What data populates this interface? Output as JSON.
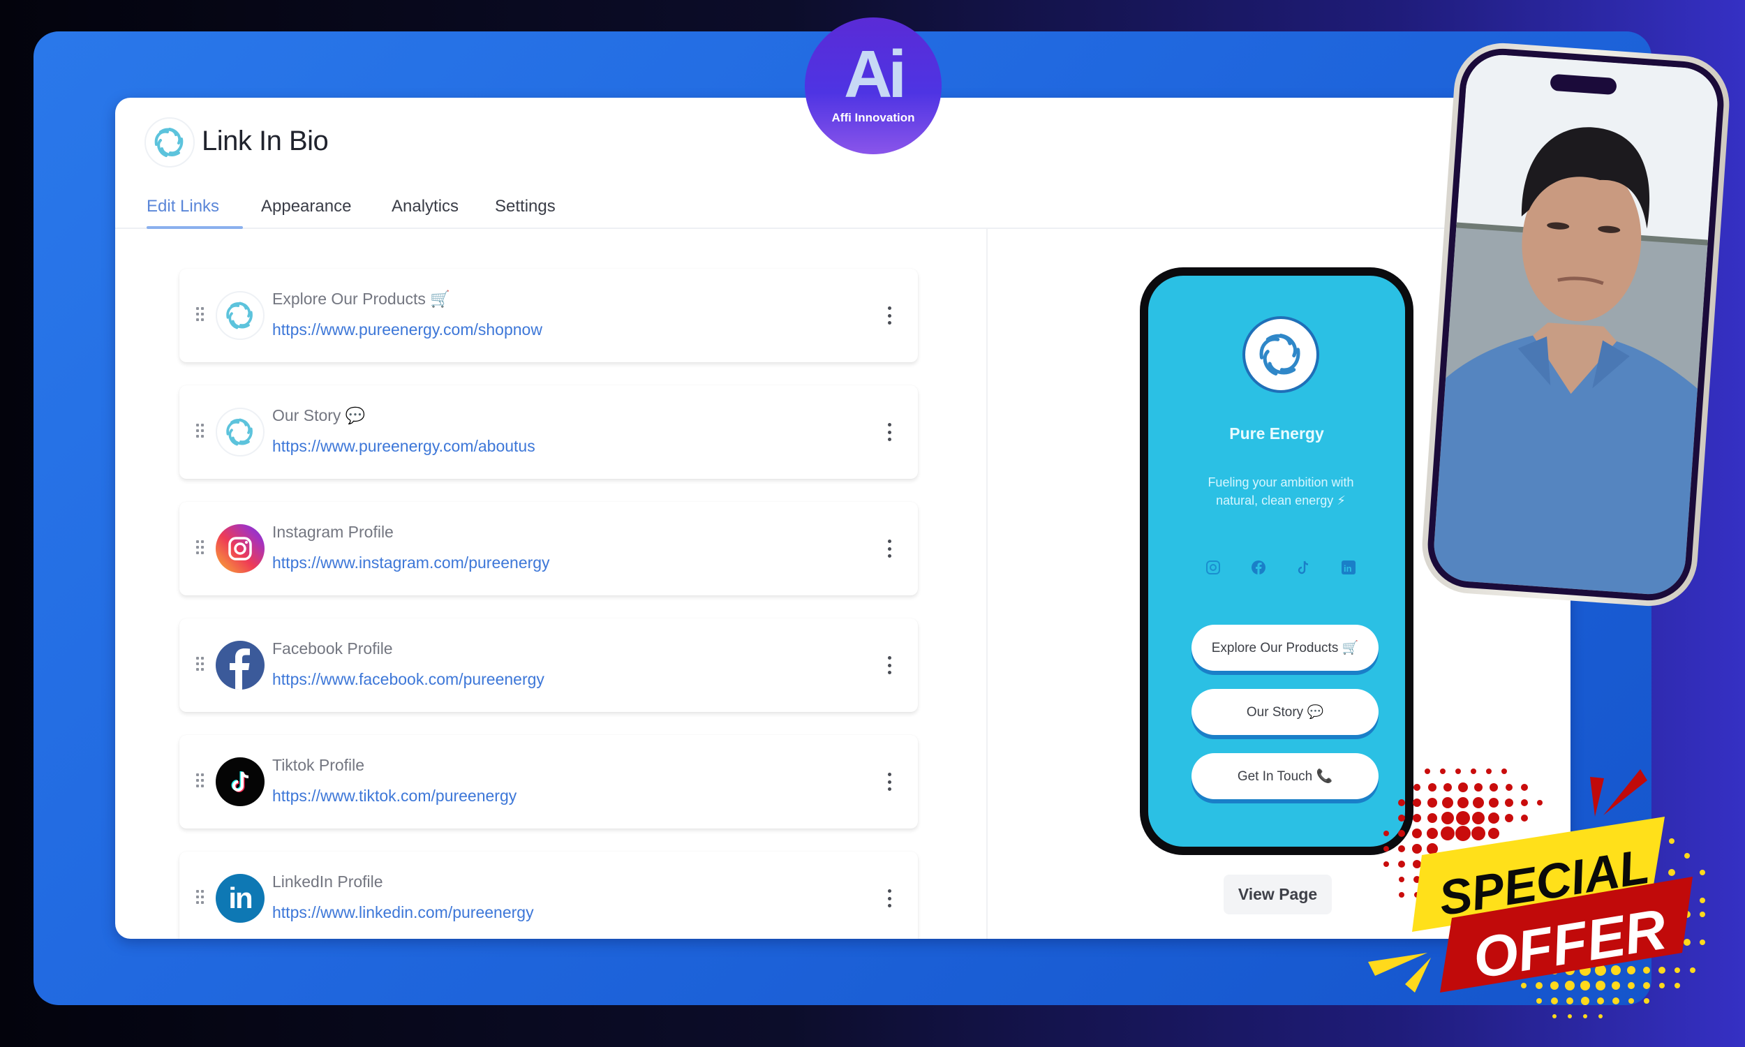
{
  "app": {
    "title": "Link In Bio",
    "logo_icon": "swirl-logo-icon"
  },
  "tabs": [
    {
      "label": "Edit Links",
      "active": true
    },
    {
      "label": "Appearance",
      "active": false
    },
    {
      "label": "Analytics",
      "active": false
    },
    {
      "label": "Settings",
      "active": false
    }
  ],
  "links": [
    {
      "title": "Explore Our Products 🛒",
      "url": "https://www.pureenergy.com/shopnow",
      "icon": "swirl-logo-icon"
    },
    {
      "title": "Our Story 💬",
      "url": "https://www.pureenergy.com/aboutus",
      "icon": "swirl-logo-icon"
    },
    {
      "title": "Instagram Profile",
      "url": "https://www.instagram.com/pureenergy",
      "icon": "instagram-icon"
    },
    {
      "title": "Facebook Profile",
      "url": "https://www.facebook.com/pureenergy",
      "icon": "facebook-icon"
    },
    {
      "title": "Tiktok Profile",
      "url": "https://www.tiktok.com/pureenergy",
      "icon": "tiktok-icon"
    },
    {
      "title": "LinkedIn Profile",
      "url": "https://www.linkedin.com/pureenergy",
      "icon": "linkedin-icon"
    }
  ],
  "preview": {
    "name": "Pure Energy",
    "bio": "Fueling your ambition with natural, clean energy ⚡",
    "social_icons": [
      "instagram-icon",
      "facebook-icon",
      "tiktok-icon",
      "linkedin-icon"
    ],
    "buttons": [
      "Explore Our Products 🛒",
      "Our Story 💬",
      "Get In Touch 📞"
    ],
    "background_color": "#2bc0e4",
    "view_page_label": "View Page"
  },
  "branding": {
    "logo_mark": "Ai",
    "logo_text": "Affi Innovation"
  },
  "promo": {
    "line1": "SPECIAL",
    "line2": "OFFER"
  },
  "colors": {
    "accent": "#3d77d8",
    "panel_blue": "#2169e0",
    "promo_yellow": "#ffe01a",
    "promo_red": "#c10a0a"
  }
}
